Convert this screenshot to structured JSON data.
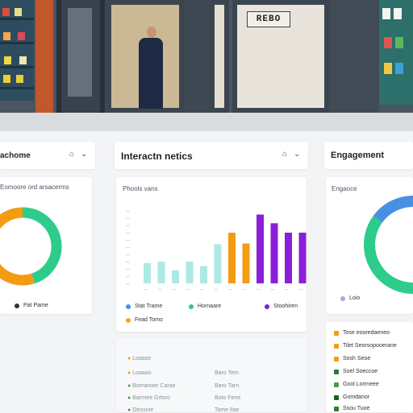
{
  "photo": {
    "sign_text": "REBO"
  },
  "left_panel": {
    "title": "achome",
    "subtitle": "Eomoore ord arsacerms",
    "legend": "Pat Pame",
    "colors": {
      "green": "#2ecc8a",
      "orange": "#f39c12"
    }
  },
  "center_panel": {
    "title": "Interactn netics",
    "chart_card": {
      "title": "Phools vans",
      "legend": [
        {
          "label": "Stat Trame",
          "color": "#4a90e2"
        },
        {
          "label": "Hornaare",
          "color": "#2ecc8a"
        },
        {
          "label": "Stoohiren",
          "color": "#7b1fd6"
        },
        {
          "label": "Fead Tomo",
          "color": "#f5a623"
        }
      ]
    },
    "list": [
      {
        "label": "Loaase",
        "value": ""
      },
      {
        "label": "Loaaao",
        "value": "Baro Tem"
      },
      {
        "label": "Bomanoer Carae",
        "value": "Baro Tarn"
      },
      {
        "label": "Barrnee Grtoro",
        "value": "Boto Fene"
      },
      {
        "label": "Dinoune",
        "value": "Tame Ilae"
      }
    ]
  },
  "right_panel": {
    "title": "Engagement",
    "donut_card_title": "Engaoce",
    "donut_legend": "Loio",
    "list": [
      {
        "label": "Tose eooredaeneo",
        "color": "#f39c12"
      },
      {
        "label": "Tilet Seorsopooerane",
        "color": "#f39c12"
      },
      {
        "label": "Sosh Seoe",
        "color": "#f39c12"
      },
      {
        "label": "Soel Soeccoe",
        "color": "#2e7d32"
      },
      {
        "label": "Gool Lorrneee",
        "color": "#43a047"
      },
      {
        "label": "Gomdanor",
        "color": "#1b5e20"
      },
      {
        "label": "Ssou Tuoe",
        "color": "#2e7d32"
      }
    ]
  },
  "chart_data": [
    {
      "type": "pie",
      "title": "Eomoore ord arsacerms",
      "slices": [
        {
          "name": "green",
          "value": 45,
          "color": "#2ecc8a"
        },
        {
          "name": "orange",
          "value": 55,
          "color": "#f39c12"
        }
      ],
      "legend": [
        "Pat Pame"
      ]
    },
    {
      "type": "bar",
      "title": "Phools vans",
      "categories": [
        "1",
        "2",
        "3",
        "4",
        "5",
        "6",
        "7",
        "8",
        "9",
        "10",
        "11",
        "12"
      ],
      "values": [
        28,
        30,
        18,
        30,
        24,
        54,
        70,
        55,
        95,
        83,
        70,
        70
      ],
      "colors": [
        "#aee8e4",
        "#aee8e4",
        "#aee8e4",
        "#aee8e4",
        "#aee8e4",
        "#aee8e4",
        "#f39c12",
        "#f39c12",
        "#8b1fd9",
        "#8b1fd9",
        "#8b1fd9",
        "#8b1fd9"
      ],
      "ylim": [
        0,
        100
      ],
      "grid": false
    },
    {
      "type": "pie",
      "title": "Engaoce",
      "slices": [
        {
          "name": "green",
          "value": 85,
          "color": "#2ecc8a"
        },
        {
          "name": "blue",
          "value": 15,
          "color": "#4a90e2"
        }
      ],
      "legend": [
        "Loio"
      ]
    }
  ]
}
